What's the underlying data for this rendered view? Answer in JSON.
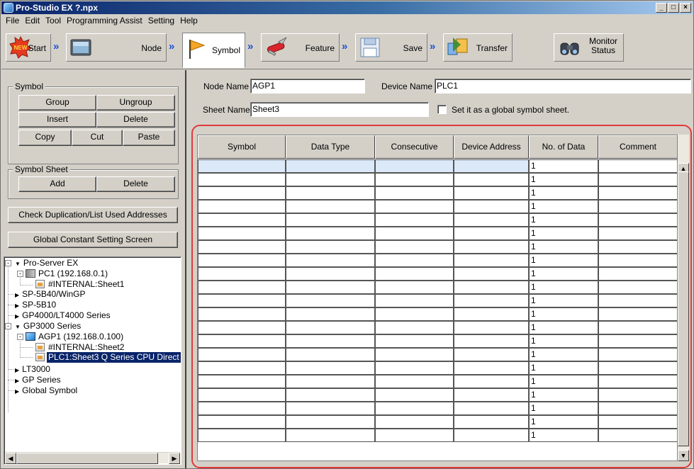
{
  "window": {
    "title": "Pro-Studio EX   ?.npx",
    "min_glyph": "_",
    "max_glyph": "□",
    "close_glyph": "×"
  },
  "menu": [
    "File",
    "Edit",
    "Tool",
    "Programming Assist",
    "Setting",
    "Help"
  ],
  "toolbar": {
    "new_badge": "NEW",
    "start": "Start",
    "node": "Node",
    "symbol": "Symbol",
    "feature": "Feature",
    "save": "Save",
    "transfer": "Transfer",
    "monitor_line1": "Monitor",
    "monitor_line2": "Status",
    "chevron": "»",
    "active_step": "symbol"
  },
  "symbol_group": {
    "title": "Symbol",
    "group": "Group",
    "ungroup": "Ungroup",
    "insert": "Insert",
    "delete": "Delete",
    "copy": "Copy",
    "cut": "Cut",
    "paste": "Paste"
  },
  "symbol_sheet_group": {
    "title": "Symbol Sheet",
    "add": "Add",
    "delete": "Delete"
  },
  "check_duplication": "Check Duplication/List Used Addresses",
  "global_constant": "Global Constant Setting Screen",
  "tree": {
    "pro_server": "Pro-Server EX",
    "pc1": "PC1 (192.168.0.1)",
    "pc1_sheet": "#INTERNAL:Sheet1",
    "sp5b40": "SP-5B40/WinGP",
    "sp5b10": "SP-5B10",
    "gp4000": "GP4000/LT4000 Series",
    "gp3000": "GP3000 Series",
    "agp1": "AGP1 (192.168.0.100)",
    "agp1_internal": "#INTERNAL:Sheet2",
    "agp1_plc": "PLC1:Sheet3 Q Series CPU Direct",
    "lt3000": "LT3000",
    "gp_series": "GP Series",
    "global_symbol": "Global Symbol",
    "expand_glyph": "-",
    "collapse_arrow": "▼",
    "expand_arrow": "▶"
  },
  "form": {
    "node_name_label": "Node Name",
    "node_name": "AGP1",
    "device_name_label": "Device Name",
    "device_name": "PLC1",
    "sheet_name_label": "Sheet Name",
    "sheet_name": "Sheet3",
    "global_checkbox_label": "Set it as a global symbol sheet.",
    "global_checked": false
  },
  "grid": {
    "columns": [
      "Symbol",
      "Data Type",
      "Consecutive",
      "Device Address",
      "No. of Data",
      "Comment"
    ],
    "default_no_of_data": "1",
    "row_count": 21,
    "selected_row": 0
  },
  "scroll": {
    "up": "▲",
    "down": "▼",
    "left": "◀",
    "right": "▶"
  },
  "colors": {
    "titlebar_start": "#0a246a",
    "highlight_border": "#e03a3a",
    "selection": "#0a246a",
    "chevron": "#1a4fd6"
  }
}
